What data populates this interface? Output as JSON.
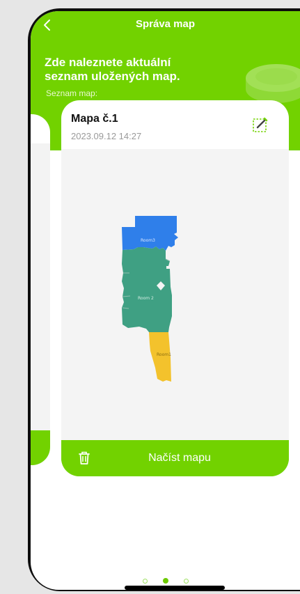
{
  "header": {
    "title": "Správa map",
    "intro": "Zde naleznete aktuální seznam uložených map.",
    "list_label": "Seznam map:"
  },
  "map_card": {
    "name": "Mapa č.1",
    "date": "2023.09.12 14:27",
    "load_button": "Načíst mapu",
    "rooms": [
      {
        "label": "Room3",
        "color": "#2f7fea"
      },
      {
        "label": "Room 2",
        "color": "#3fa083"
      },
      {
        "label": "Room1",
        "color": "#f3c22c"
      }
    ]
  },
  "pager": {
    "count": 3,
    "active_index": 1
  },
  "colors": {
    "accent": "#72d200",
    "map_background": "#f4f4f4"
  },
  "icons": {
    "back": "chevron-left-icon",
    "edit": "edit-icon",
    "delete": "trash-icon"
  }
}
